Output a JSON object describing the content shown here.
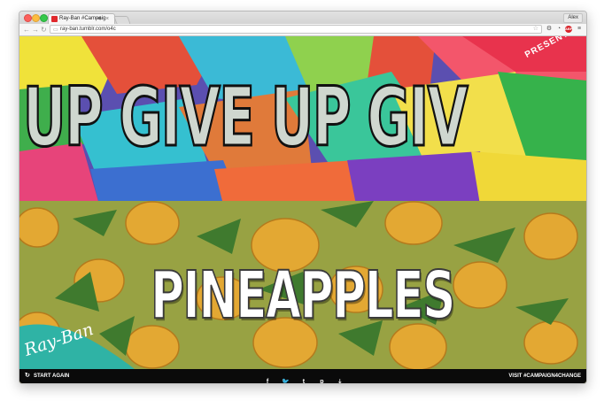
{
  "browser": {
    "tab_title": "Ray-Ban #CampaignF...",
    "tab_audio_icon": "speaker-icon",
    "tab_close": "×",
    "profile_name": "Alex",
    "url": "ray-ban.tumblr.com/o4c",
    "nav": {
      "back": "←",
      "forward": "→",
      "reload": "↻"
    }
  },
  "hero": {
    "phrase_top": "UP GIVE UP GIV",
    "phrase_bottom": "PINEAPPLES",
    "presents_text": "PRESENTS",
    "brand_logo": "Ray-Ban"
  },
  "footer": {
    "start_again_label": "START AGAIN",
    "visit_label": "VISIT #CAMPAIGN4CHANGE",
    "share_icons": [
      "facebook-icon",
      "twitter-icon",
      "tumblr-icon",
      "pinterest-icon",
      "download-icon"
    ],
    "share_glyphs": [
      "f",
      "🐦",
      "t",
      "p",
      "⤓"
    ]
  },
  "colors": {
    "footer_bg": "#0a0a0a",
    "accent_red": "#e0282c",
    "pineapple_bg": "#8f9a3e"
  }
}
